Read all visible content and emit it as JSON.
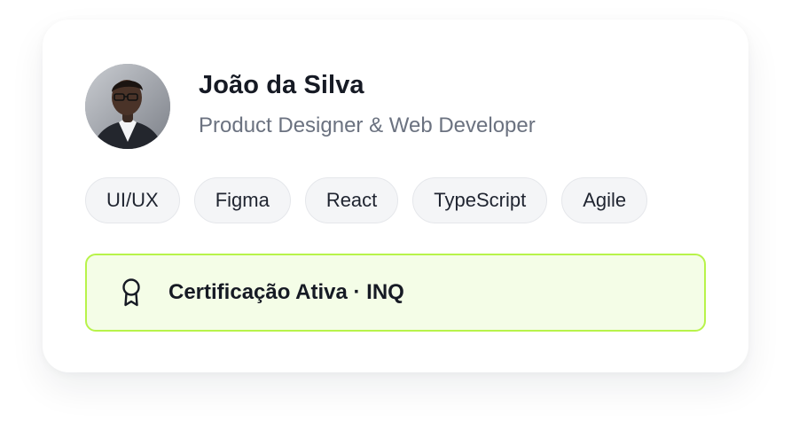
{
  "profile": {
    "name": "João da Silva",
    "role": "Product Designer & Web Developer",
    "avatar_icon": "profile-photo"
  },
  "tags": [
    "UI/UX",
    "Figma",
    "React",
    "TypeScript",
    "Agile"
  ],
  "certification": {
    "icon": "award-icon",
    "label": "Certificação Ativa · INQ"
  },
  "colors": {
    "accent_border": "#b8f34a",
    "accent_bg": "#f4fde7",
    "tag_bg": "#f4f5f7",
    "name_text": "#161a24",
    "role_text": "#6b7280"
  }
}
